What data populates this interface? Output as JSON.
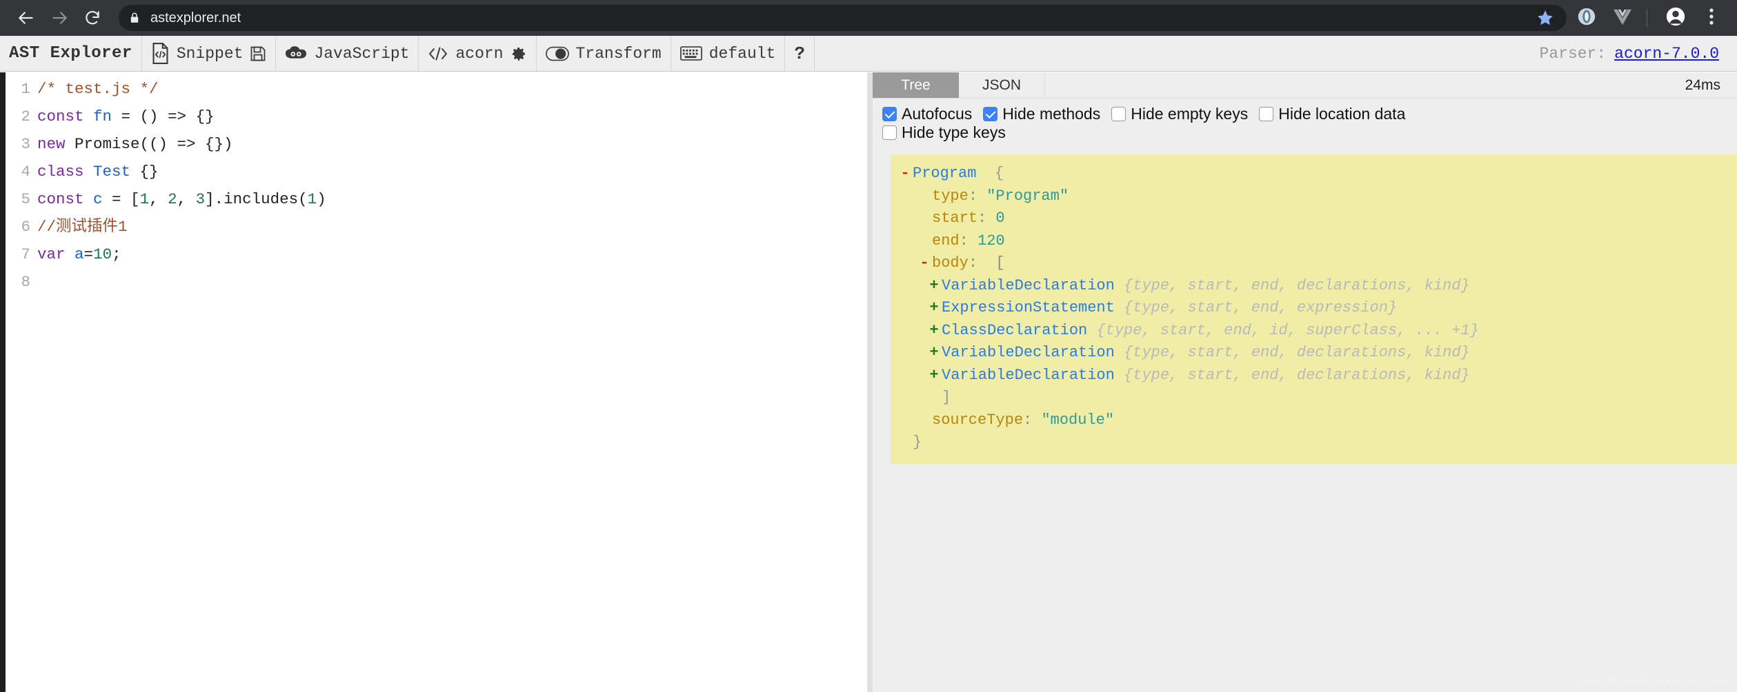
{
  "browser": {
    "url": "astexplorer.net",
    "back_icon": "back-arrow-icon",
    "forward_icon": "forward-arrow-icon",
    "reload_icon": "reload-icon",
    "lock_icon": "lock-icon",
    "star_icon": "star-icon",
    "extension_1_icon": "opera-extension-icon",
    "extension_2_icon": "vue-devtools-icon",
    "profile_icon": "profile-avatar-icon",
    "menu_icon": "three-dot-menu-icon"
  },
  "toolbar": {
    "app_title": "AST Explorer",
    "snippet_label": "Snippet",
    "snippet_icon": "code-file-icon",
    "save_icon": "floppy-save-icon",
    "language_label": "JavaScript",
    "language_icon": "infinity-cloud-icon",
    "parser_label": "acorn",
    "parser_icon": "code-brackets-icon",
    "settings_icon": "gear-icon",
    "transform_label": "Transform",
    "transform_icon": "toggle-circles-icon",
    "keymap_label": "default",
    "keymap_icon": "keyboard-icon",
    "help_label": "?",
    "parser_prefix": "Parser:",
    "parser_version": "acorn-7.0.0"
  },
  "editor": {
    "lines": [
      {
        "n": "1",
        "tokens": [
          {
            "t": "/* test.js */",
            "c": "tok-comment"
          }
        ]
      },
      {
        "n": "2",
        "tokens": [
          {
            "t": "const",
            "c": "tok-kw"
          },
          {
            "t": " ",
            "c": "tok-plain"
          },
          {
            "t": "fn",
            "c": "tok-def"
          },
          {
            "t": " = () => {}",
            "c": "tok-plain"
          }
        ]
      },
      {
        "n": "3",
        "tokens": [
          {
            "t": "new",
            "c": "tok-kw"
          },
          {
            "t": " Promise(() => {})",
            "c": "tok-plain"
          }
        ]
      },
      {
        "n": "4",
        "tokens": [
          {
            "t": "class",
            "c": "tok-kw"
          },
          {
            "t": " ",
            "c": "tok-plain"
          },
          {
            "t": "Test",
            "c": "tok-def"
          },
          {
            "t": " {}",
            "c": "tok-plain"
          }
        ]
      },
      {
        "n": "5",
        "tokens": [
          {
            "t": "const",
            "c": "tok-kw"
          },
          {
            "t": " ",
            "c": "tok-plain"
          },
          {
            "t": "c",
            "c": "tok-def"
          },
          {
            "t": " = [",
            "c": "tok-plain"
          },
          {
            "t": "1",
            "c": "tok-num"
          },
          {
            "t": ", ",
            "c": "tok-plain"
          },
          {
            "t": "2",
            "c": "tok-num"
          },
          {
            "t": ", ",
            "c": "tok-plain"
          },
          {
            "t": "3",
            "c": "tok-num"
          },
          {
            "t": "].includes(",
            "c": "tok-plain"
          },
          {
            "t": "1",
            "c": "tok-num"
          },
          {
            "t": ")",
            "c": "tok-plain"
          }
        ]
      },
      {
        "n": "6",
        "tokens": [
          {
            "t": "//测试插件1",
            "c": "tok-comment"
          }
        ]
      },
      {
        "n": "7",
        "tokens": [
          {
            "t": "var",
            "c": "tok-kw"
          },
          {
            "t": " ",
            "c": "tok-plain"
          },
          {
            "t": "a",
            "c": "tok-def"
          },
          {
            "t": "=",
            "c": "tok-plain"
          },
          {
            "t": "10",
            "c": "tok-num"
          },
          {
            "t": ";",
            "c": "tok-plain"
          }
        ]
      },
      {
        "n": "8",
        "tokens": [
          {
            "t": "",
            "c": "tok-plain"
          }
        ]
      }
    ]
  },
  "output": {
    "tabs": [
      {
        "label": "Tree",
        "active": true
      },
      {
        "label": "JSON",
        "active": false
      }
    ],
    "timing": "24ms",
    "options": [
      {
        "label": "Autofocus",
        "checked": true
      },
      {
        "label": "Hide methods",
        "checked": true
      },
      {
        "label": "Hide empty keys",
        "checked": false
      },
      {
        "label": "Hide location data",
        "checked": false
      },
      {
        "label": "Hide type keys",
        "checked": false
      }
    ],
    "tree": [
      {
        "toggle": "-",
        "indent": 0,
        "parts": [
          {
            "t": "Program",
            "c": "t-node"
          },
          {
            "t": "  {",
            "c": "t-brace"
          }
        ]
      },
      {
        "toggle": "",
        "indent": 1,
        "parts": [
          {
            "t": "type",
            "c": "t-key"
          },
          {
            "t": ": ",
            "c": "t-colon"
          },
          {
            "t": "\"Program\"",
            "c": "t-str"
          }
        ]
      },
      {
        "toggle": "",
        "indent": 1,
        "parts": [
          {
            "t": "start",
            "c": "t-key"
          },
          {
            "t": ": ",
            "c": "t-colon"
          },
          {
            "t": "0",
            "c": "t-num"
          }
        ]
      },
      {
        "toggle": "",
        "indent": 1,
        "parts": [
          {
            "t": "end",
            "c": "t-key"
          },
          {
            "t": ": ",
            "c": "t-colon"
          },
          {
            "t": "120",
            "c": "t-num"
          }
        ]
      },
      {
        "toggle": "-",
        "indent": 1,
        "parts": [
          {
            "t": "body",
            "c": "t-key"
          },
          {
            "t": ":  [",
            "c": "t-colon"
          }
        ]
      },
      {
        "toggle": "+",
        "indent": 2,
        "parts": [
          {
            "t": "VariableDeclaration",
            "c": "t-node"
          },
          {
            "t": " ",
            "c": "t-brace"
          },
          {
            "t": "{type, start, end, declarations, kind}",
            "c": "t-preview"
          }
        ]
      },
      {
        "toggle": "+",
        "indent": 2,
        "parts": [
          {
            "t": "ExpressionStatement",
            "c": "t-node"
          },
          {
            "t": " ",
            "c": "t-brace"
          },
          {
            "t": "{type, start, end, expression}",
            "c": "t-preview"
          }
        ]
      },
      {
        "toggle": "+",
        "indent": 2,
        "parts": [
          {
            "t": "ClassDeclaration",
            "c": "t-node"
          },
          {
            "t": " ",
            "c": "t-brace"
          },
          {
            "t": "{type, start, end, id, superClass, ... +1}",
            "c": "t-preview"
          }
        ]
      },
      {
        "toggle": "+",
        "indent": 2,
        "parts": [
          {
            "t": "VariableDeclaration",
            "c": "t-node"
          },
          {
            "t": " ",
            "c": "t-brace"
          },
          {
            "t": "{type, start, end, declarations, kind}",
            "c": "t-preview"
          }
        ]
      },
      {
        "toggle": "+",
        "indent": 2,
        "parts": [
          {
            "t": "VariableDeclaration",
            "c": "t-node"
          },
          {
            "t": " ",
            "c": "t-brace"
          },
          {
            "t": "{type, start, end, declarations, kind}",
            "c": "t-preview"
          }
        ]
      },
      {
        "toggle": "",
        "indent": 2,
        "parts": [
          {
            "t": "]",
            "c": "t-brace"
          }
        ]
      },
      {
        "toggle": "",
        "indent": 1,
        "parts": [
          {
            "t": "sourceType",
            "c": "t-key"
          },
          {
            "t": ": ",
            "c": "t-colon"
          },
          {
            "t": "\"module\"",
            "c": "t-str"
          }
        ]
      },
      {
        "toggle": "",
        "indent": 0,
        "parts": [
          {
            "t": "}",
            "c": "t-brace"
          }
        ]
      }
    ]
  },
  "watermark": "https://vvbug.blog.csdn.net",
  "colors": {
    "chrome_bg": "#35363a",
    "omnibox_bg": "#202124",
    "toolbar_bg": "#eeeeee",
    "tree_bg": "#f0eda7",
    "accent_checkbox": "#3b82f6",
    "link": "#1919d6",
    "tab_active_bg": "#9a9a9a"
  }
}
